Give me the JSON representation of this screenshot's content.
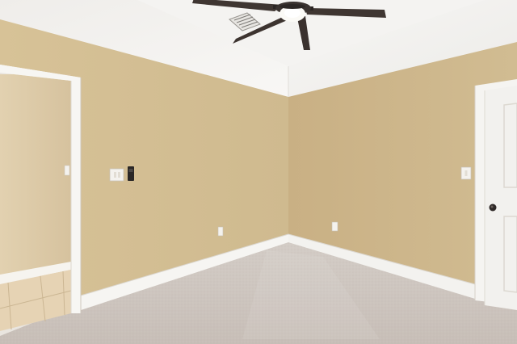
{
  "scene": {
    "subject": "empty-carpeted-room",
    "colors": {
      "wall_left": "#d6c096",
      "wall_right": "#cfb88c",
      "ceiling": "#f2f0ee",
      "carpet": "#cdc5bf",
      "trim": "#f6f5f2",
      "fan_blade": "#3f3632",
      "floor_tile": "#e6d2b2"
    },
    "icons": [
      "ceiling-fan-icon",
      "light-switch-icon",
      "thermostat-icon",
      "outlet-icon",
      "door-knob-icon"
    ]
  }
}
